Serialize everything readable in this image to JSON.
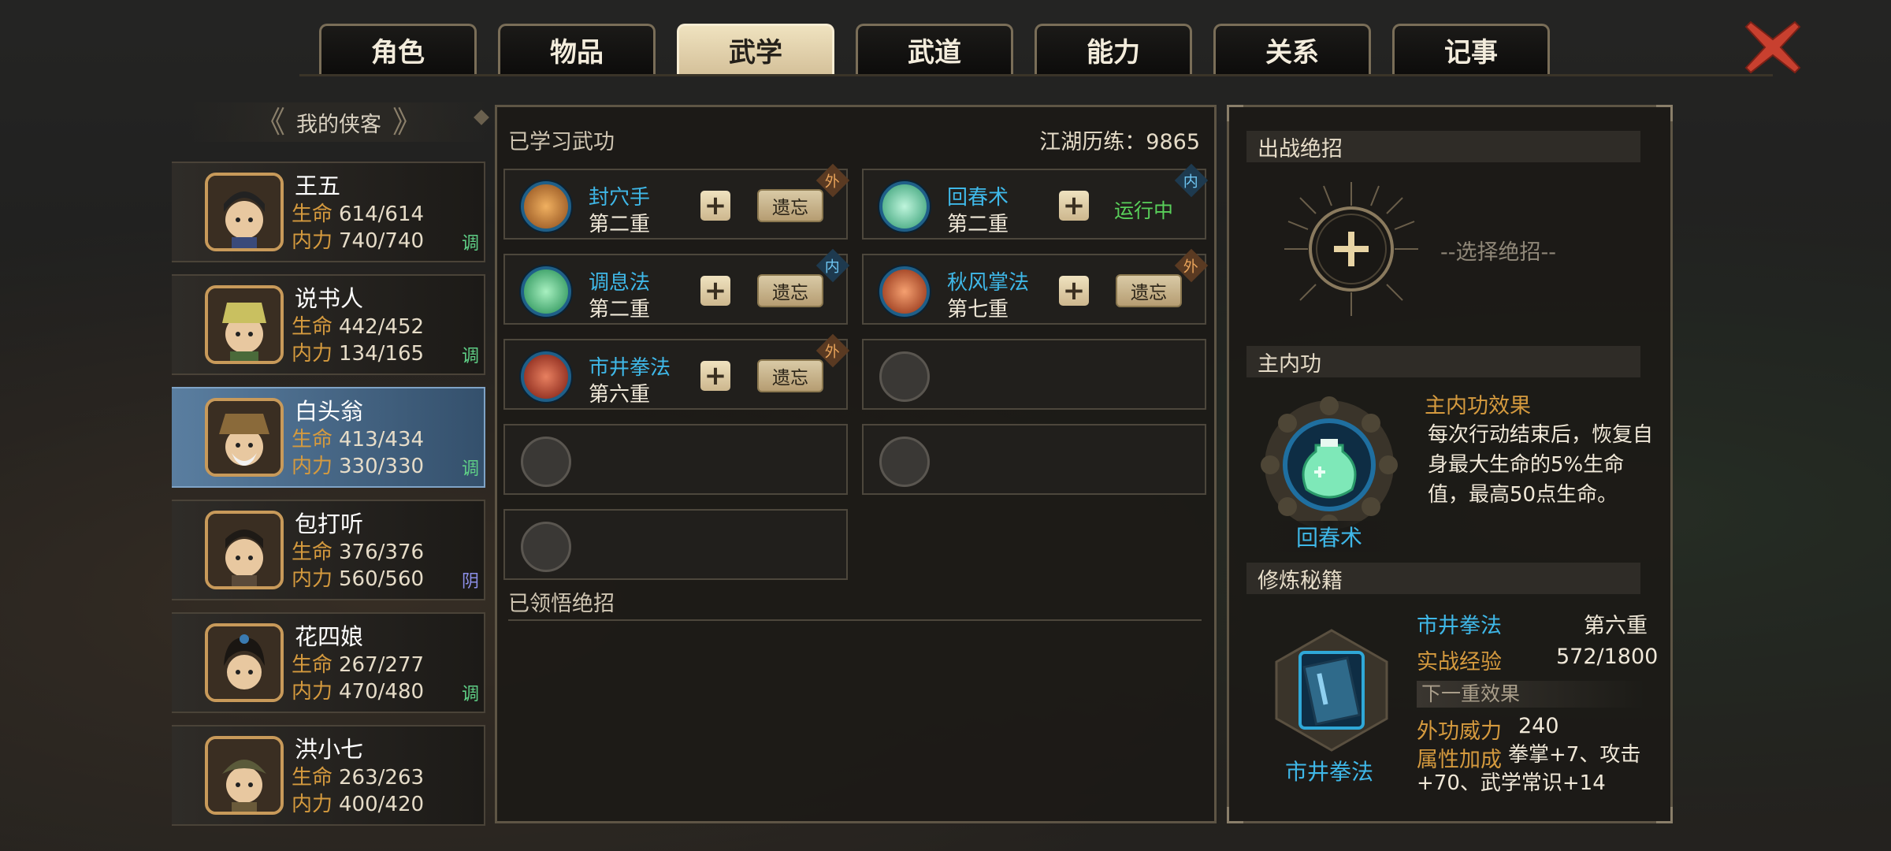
{
  "tabs": [
    "角色",
    "物品",
    "武学",
    "武道",
    "能力",
    "关系",
    "记事"
  ],
  "active_tab": 2,
  "roster": {
    "title": "我的侠客",
    "heroes": [
      {
        "name": "王五",
        "hp_label": "生命",
        "hp": "614/614",
        "mp_label": "内力",
        "mp": "740/740",
        "tag": "调",
        "tag_color": "#5fcf86"
      },
      {
        "name": "说书人",
        "hp_label": "生命",
        "hp": "442/452",
        "mp_label": "内力",
        "mp": "134/165",
        "tag": "调",
        "tag_color": "#5fcf86"
      },
      {
        "name": "白头翁",
        "hp_label": "生命",
        "hp": "413/434",
        "mp_label": "内力",
        "mp": "330/330",
        "tag": "调",
        "tag_color": "#5fcf86"
      },
      {
        "name": "包打听",
        "hp_label": "生命",
        "hp": "376/376",
        "mp_label": "内力",
        "mp": "560/560",
        "tag": "阴",
        "tag_color": "#8c8fe8"
      },
      {
        "name": "花四娘",
        "hp_label": "生命",
        "hp": "267/277",
        "mp_label": "内力",
        "mp": "470/480",
        "tag": "调",
        "tag_color": "#5fcf86"
      },
      {
        "name": "洪小七",
        "hp_label": "生命",
        "hp": "263/263",
        "mp_label": "内力",
        "mp": "400/420",
        "tag": "",
        "tag_color": "#5fcf86"
      }
    ]
  },
  "skills": {
    "title": "已学习武功",
    "exp_text": "江湖历练：9865",
    "learned": [
      {
        "name": "封穴手",
        "level": "第二重",
        "badge": "外",
        "badge_type": "out",
        "action": "遗忘",
        "icon_color": "#c97a2a"
      },
      {
        "name": "回春术",
        "level": "第二重",
        "badge": "内",
        "badge_type": "in",
        "status": "运行中",
        "icon_color": "#5fd6a0"
      },
      {
        "name": "调息法",
        "level": "第二重",
        "badge": "内",
        "badge_type": "in",
        "action": "遗忘",
        "icon_color": "#4fd08a"
      },
      {
        "name": "秋风掌法",
        "level": "第七重",
        "badge": "外",
        "badge_type": "out",
        "action": "遗忘",
        "icon_color": "#d0502a"
      },
      {
        "name": "市井拳法",
        "level": "第六重",
        "badge": "外",
        "badge_type": "out",
        "action": "遗忘",
        "icon_color": "#b0402a"
      }
    ],
    "ultimate_title": "已领悟绝招"
  },
  "right": {
    "ultimate_header": "出战绝招",
    "ultimate_hint": "--选择绝招--",
    "main_header": "主内功",
    "main_name": "回春术",
    "main_effect_title": "主内功效果",
    "main_effect_desc": "每次行动结束后，恢复自身最大生命的5%生命值，最高50点生命。",
    "train_header": "修炼秘籍",
    "book_name": "市井拳法",
    "book_skill": "市井拳法",
    "book_level": "第六重",
    "exp_label": "实战经验",
    "exp_value": "572/1800",
    "next_label": "下一重效果",
    "power_label": "外功威力",
    "power_value": "240",
    "attr_label": "属性加成",
    "attr_desc": "拳掌+7、攻击+70、武学常识+14"
  }
}
